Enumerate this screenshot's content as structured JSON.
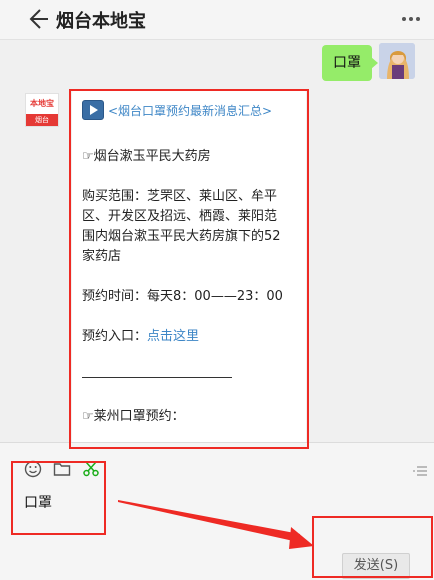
{
  "header": {
    "title": "烟台本地宝",
    "back_icon": "back-arrow-icon",
    "more_icon": "more-dots-icon"
  },
  "chat": {
    "sent_message": {
      "text": "口罩",
      "bubble_color": "#95ec69"
    },
    "bot": {
      "avatar_top": "本地宝",
      "avatar_bottom": "烟台",
      "brand_color": "#e53935"
    },
    "card": {
      "link_text": "<烟台口罩预约最新消息汇总>",
      "store_title": "☞烟台漱玉平民大药房",
      "scope_lines": [
        "购买范围：芝罘区、莱山区、牟平",
        "区、开发区及招远、栖霞、莱阳范",
        "围内烟台漱玉平民大药房旗下的52",
        "家药店"
      ],
      "time_text": "预约时间：每天8：00——23：00",
      "entry_label": "预约入口：",
      "entry_link": "点击这里",
      "next_title": "☞莱州口罩预约：",
      "link_color": "#3d86c6"
    }
  },
  "composer": {
    "tools": [
      "emoji-icon",
      "folder-icon",
      "scissors-icon"
    ],
    "input_value": "口罩",
    "send_label": "发送(S)"
  },
  "annotation_color": "#ee2a24"
}
